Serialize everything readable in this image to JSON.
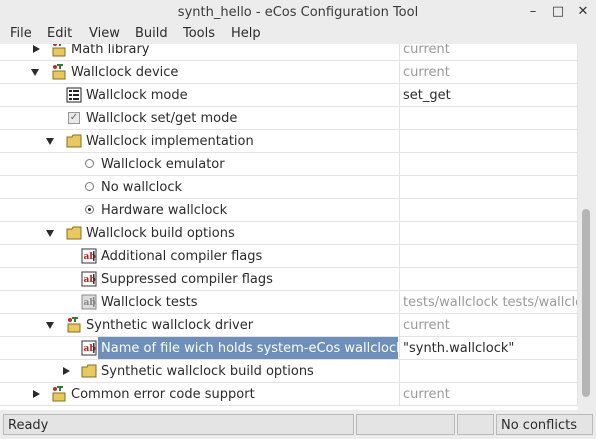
{
  "window": {
    "title": "synth_hello - eCos Configuration Tool",
    "controls": [
      "–",
      "□",
      "✕"
    ]
  },
  "menu": [
    "File",
    "Edit",
    "View",
    "Build",
    "Tools",
    "Help"
  ],
  "rows": [
    {
      "label": "Math library",
      "value": "current"
    },
    {
      "label": "Wallclock device",
      "value": "current"
    },
    {
      "label": "Wallclock mode",
      "value": "set_get"
    },
    {
      "label": "Wallclock set/get mode",
      "value": ""
    },
    {
      "label": "Wallclock implementation",
      "value": ""
    },
    {
      "label": "Wallclock emulator",
      "value": ""
    },
    {
      "label": "No wallclock",
      "value": ""
    },
    {
      "label": "Hardware wallclock",
      "value": ""
    },
    {
      "label": "Wallclock build options",
      "value": ""
    },
    {
      "label": "Additional compiler flags",
      "value": ""
    },
    {
      "label": "Suppressed compiler flags",
      "value": ""
    },
    {
      "label": "Wallclock tests",
      "value": "tests/wallclock tests/wallclock"
    },
    {
      "label": "Synthetic wallclock driver",
      "value": "current"
    },
    {
      "label": "Name of file wich holds system-eCos wallclock offs",
      "value": "\"synth.wallclock\""
    },
    {
      "label": "Synthetic wallclock build options",
      "value": ""
    },
    {
      "label": "Common error code support",
      "value": "current"
    }
  ],
  "status": {
    "ready": "Ready",
    "conflicts": "No conflicts"
  },
  "colors": {
    "selection": "#6d8fba",
    "chrome": "#ececec",
    "folder": "#e8c860",
    "package": "#2e7d32"
  }
}
